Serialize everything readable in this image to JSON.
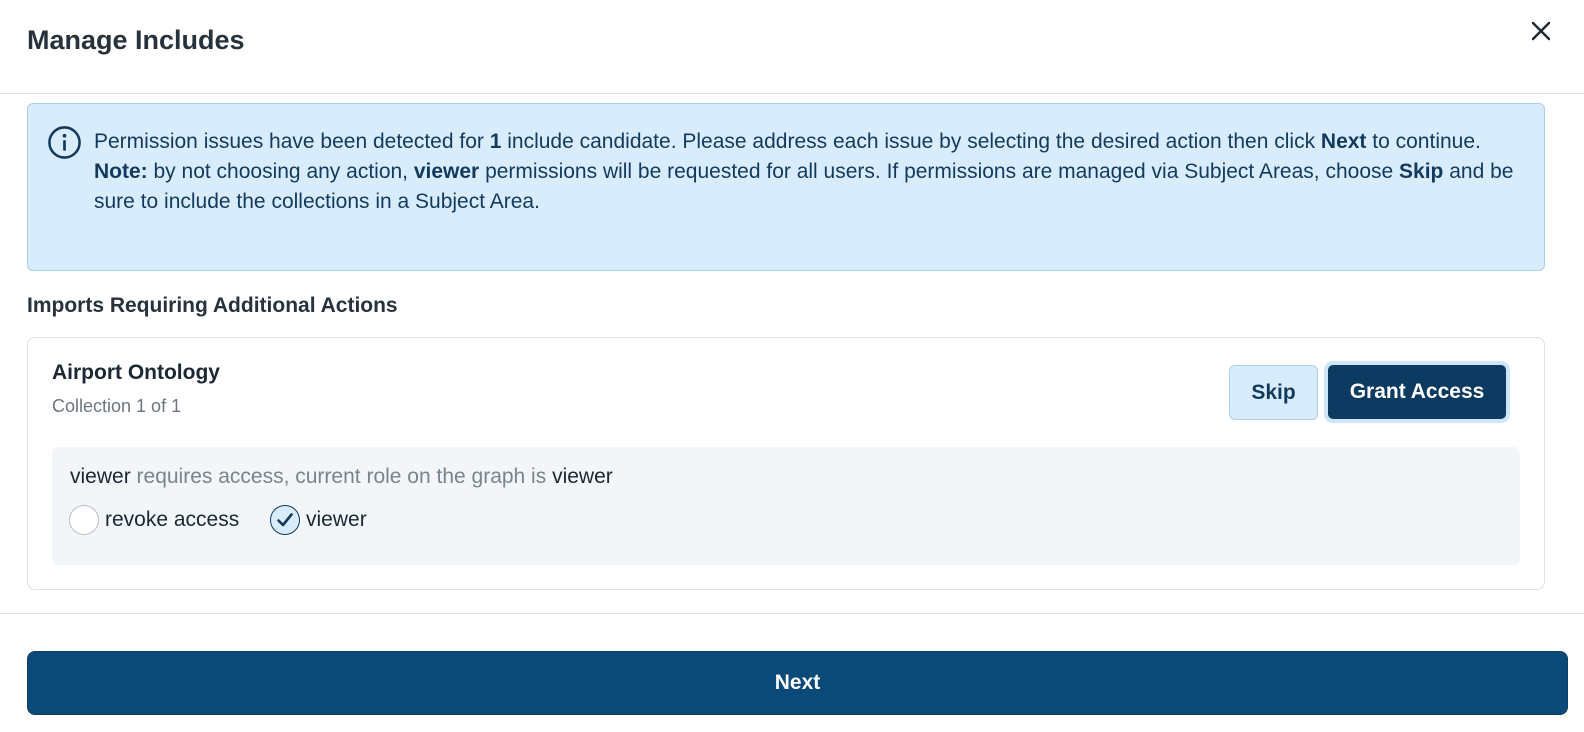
{
  "header": {
    "title": "Manage Includes",
    "close_icon": "close-icon"
  },
  "alert": {
    "icon": "info-icon",
    "line1_pre": "Permission issues have been detected for ",
    "line1_count": "1",
    "line1_mid": " include candidate. Please address each issue by selecting the desired action then click ",
    "line1_next": "Next",
    "line1_post": " to continue.",
    "note_label": "Note:",
    "note_pre": " by not choosing any action, ",
    "note_role": "viewer",
    "note_mid": " permissions will be requested for all users. If permissions are managed via Subject Areas, choose ",
    "note_skip": "Skip",
    "note_post": " and be sure to include the collections in a Subject Area."
  },
  "section": {
    "title": "Imports Requiring Additional Actions"
  },
  "card": {
    "title": "Airport Ontology",
    "subtitle": "Collection 1 of 1",
    "skip_label": "Skip",
    "grant_label": "Grant Access",
    "role_user": "viewer",
    "role_text": " requires access, current role on the graph is ",
    "role_current": "viewer",
    "options": [
      {
        "label": "revoke access",
        "checked": false
      },
      {
        "label": "viewer",
        "checked": true
      }
    ]
  },
  "footer": {
    "next_label": "Next"
  },
  "colors": {
    "primary": "#0b4a78",
    "alert_bg": "#d9ecfc",
    "alert_text": "#123a5c"
  }
}
